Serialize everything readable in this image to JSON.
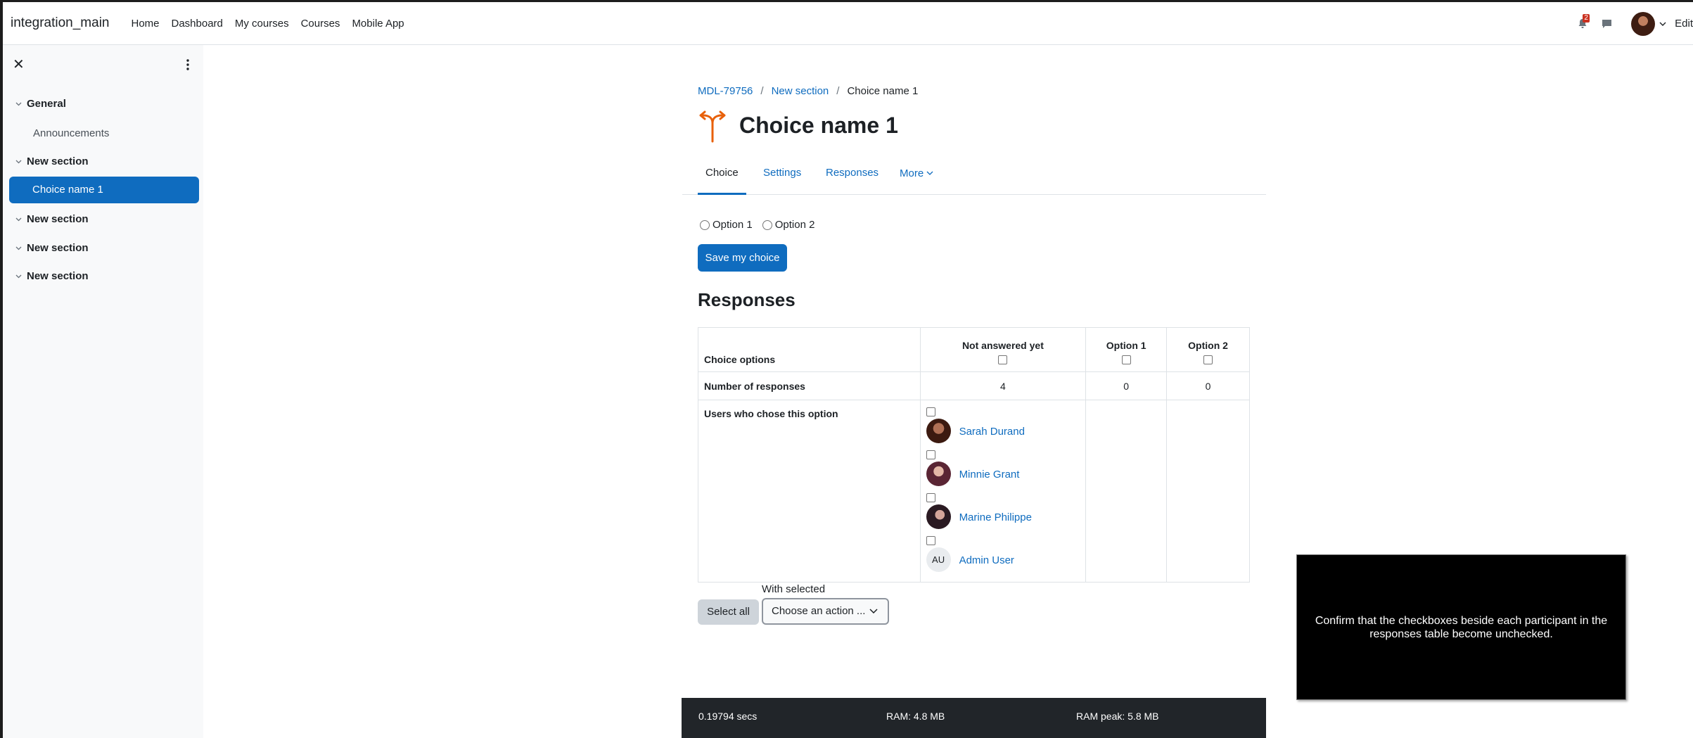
{
  "navbar": {
    "brand": "integration_main",
    "links": [
      "Home",
      "Dashboard",
      "My courses",
      "Courses",
      "Mobile App"
    ],
    "notification_count": "2",
    "edit_label": "Edit"
  },
  "drawer": {
    "sections": [
      {
        "label": "General",
        "items": [
          "Announcements"
        ]
      },
      {
        "label": "New section",
        "items": [
          "Choice name 1"
        ]
      },
      {
        "label": "New section",
        "items": []
      },
      {
        "label": "New section",
        "items": []
      },
      {
        "label": "New section",
        "items": []
      }
    ],
    "active_item": "Choice name 1"
  },
  "breadcrumb": [
    "MDL-79756",
    "New section",
    "Choice name 1"
  ],
  "page_title": "Choice name 1",
  "tabs": [
    "Choice",
    "Settings",
    "Responses",
    "More"
  ],
  "choice": {
    "options": [
      "Option 1",
      "Option 2"
    ],
    "save_label": "Save my choice"
  },
  "responses": {
    "heading": "Responses",
    "row_labels": [
      "Choice options",
      "Number of responses",
      "Users who chose this option"
    ],
    "columns": [
      {
        "label": "Not answered yet",
        "count": "4"
      },
      {
        "label": "Option 1",
        "count": "0"
      },
      {
        "label": "Option 2",
        "count": "0"
      }
    ],
    "users": [
      {
        "name": "Sarah Durand",
        "initials": ""
      },
      {
        "name": "Minnie Grant",
        "initials": ""
      },
      {
        "name": "Marine Philippe",
        "initials": ""
      },
      {
        "name": "Admin User",
        "initials": "AU"
      }
    ],
    "select_all_label": "Select all",
    "with_selected_label": "With selected",
    "action_placeholder": "Choose an action ..."
  },
  "footer": {
    "time": "0.19794 secs",
    "ram": "RAM: 4.8 MB",
    "ram_peak": "RAM peak: 5.8 MB"
  },
  "instruction": "Confirm that the checkboxes beside each participant in the responses table become unchecked.",
  "colors": {
    "accent": "#0f6cbf",
    "footer_bg": "#212529",
    "drawer_bg": "#f8f9fa",
    "badge": "#ca3120",
    "choice_icon": "#e8600a"
  }
}
